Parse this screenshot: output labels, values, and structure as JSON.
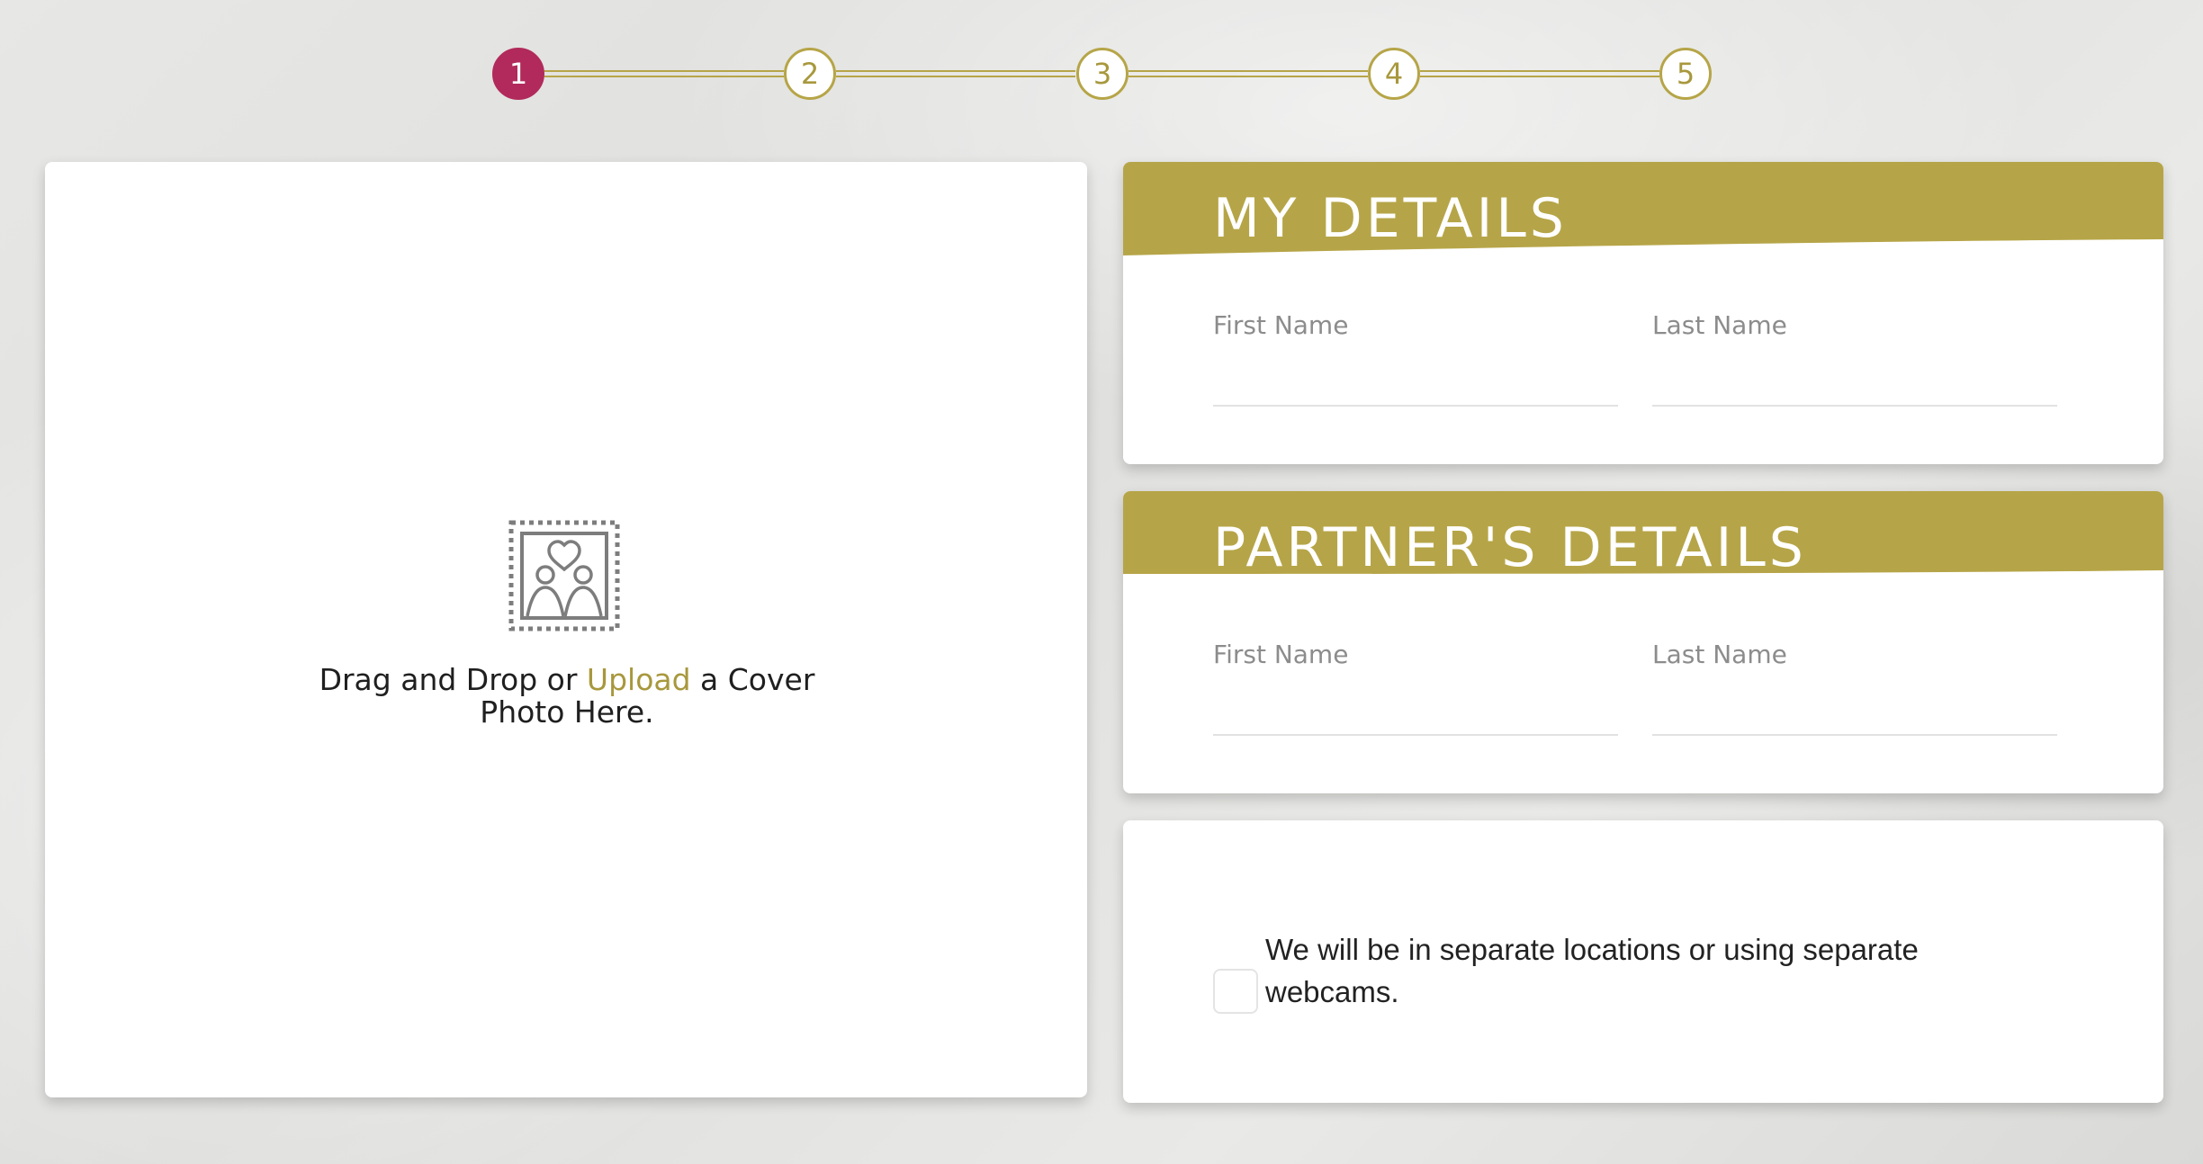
{
  "stepper": {
    "steps": [
      "1",
      "2",
      "3",
      "4",
      "5"
    ],
    "active_step": "1"
  },
  "upload": {
    "icon": "couple-photo-stamp-icon",
    "text_before": "Drag and Drop or ",
    "link_label": "Upload",
    "text_after": " a Cover Photo Here."
  },
  "my_details": {
    "title": "MY DETAILS",
    "first_name_label": "First Name",
    "first_name_value": "",
    "last_name_label": "Last Name",
    "last_name_value": ""
  },
  "partner_details": {
    "title": "PARTNER'S DETAILS",
    "first_name_label": "First Name",
    "first_name_value": "",
    "last_name_label": "Last Name",
    "last_name_value": ""
  },
  "separate_locations": {
    "label": "We will be in separate locations or using separate webcams.",
    "checked": false
  },
  "colors": {
    "accent_gold": "#b6a548",
    "active_step": "#b12a5b",
    "card_background": "#ffffff"
  }
}
